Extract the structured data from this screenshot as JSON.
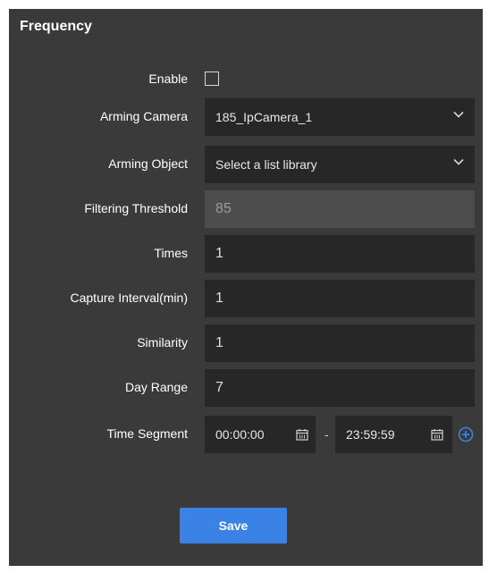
{
  "panel": {
    "title": "Frequency"
  },
  "form": {
    "enable": {
      "label": "Enable",
      "checked": false
    },
    "arming_camera": {
      "label": "Arming Camera",
      "value": "185_IpCamera_1"
    },
    "arming_object": {
      "label": "Arming Object",
      "placeholder": "Select a list library"
    },
    "filtering_threshold": {
      "label": "Filtering Threshold",
      "value": "85"
    },
    "times": {
      "label": "Times",
      "value": "1"
    },
    "capture_interval": {
      "label": "Capture Interval(min)",
      "value": "1"
    },
    "similarity": {
      "label": "Similarity",
      "value": "1"
    },
    "day_range": {
      "label": "Day Range",
      "value": "7"
    },
    "time_segment": {
      "label": "Time Segment",
      "start": "00:00:00",
      "separator": "-",
      "end": "23:59:59"
    }
  },
  "actions": {
    "save_label": "Save"
  },
  "colors": {
    "panel_bg": "#3a3a3a",
    "field_bg": "#272727",
    "disabled_bg": "#4d4d4d",
    "accent": "#3b82e6"
  },
  "icons": {
    "dropdown": "chevron-down-icon",
    "calendar": "calendar-icon",
    "add": "plus-circle-icon"
  }
}
